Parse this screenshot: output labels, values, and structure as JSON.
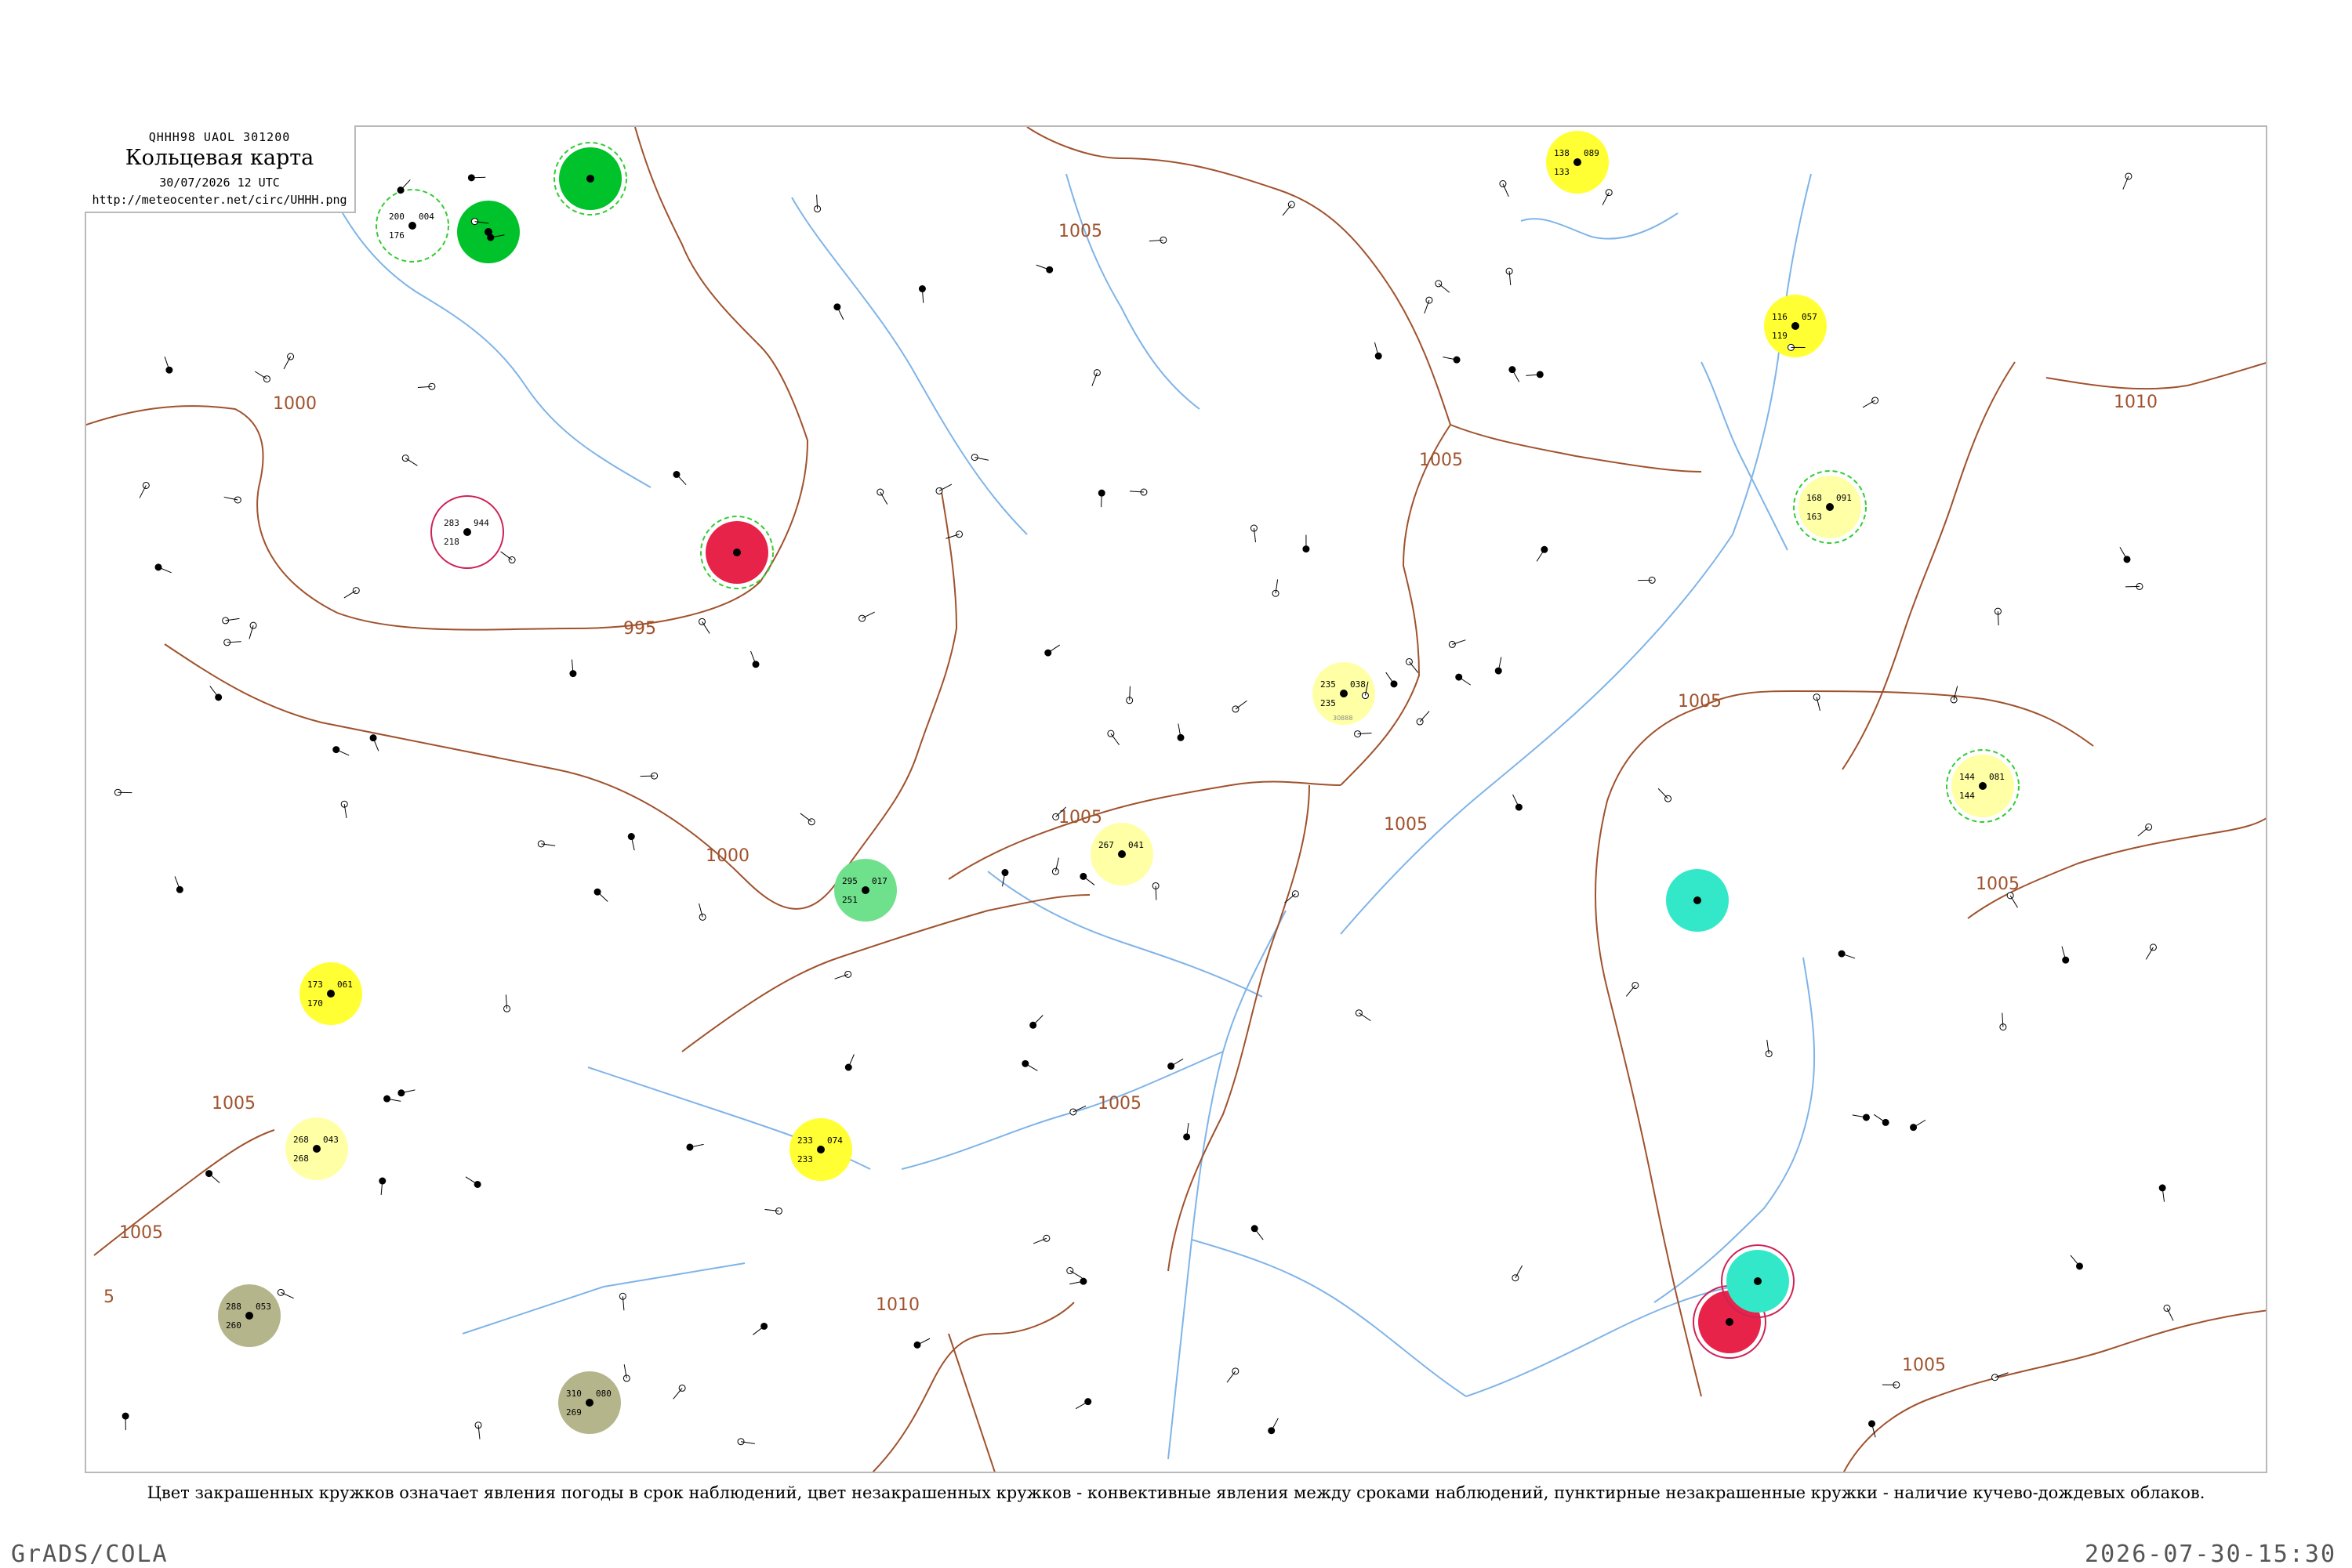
{
  "header": {
    "code": "QHHH98 UAOL 301200",
    "title": "Кольцевая карта",
    "date": "30/07/2026 12 UTC",
    "url": "http://meteocenter.net/circ/UHHH.png"
  },
  "caption": "Цвет закрашенных кружков означает явления погоды в срок наблюдений, цвет незакрашенных кружков - конвективные явления между сроками наблюдений, пунктирные незакрашенные кружки - наличие кучево-дождевых облаков.",
  "footer": {
    "left": "GrADS/COLA",
    "right": "2026-07-30-15:30"
  },
  "colors": {
    "isobar": "#a0522d",
    "rivers": "#7fb4e8",
    "frame": "#b9b9b9",
    "green": "#00c22a",
    "yellow": "#ffff33",
    "pale_yellow": "#ffffa6",
    "red": "#e8234a",
    "cyan": "#33e8c8",
    "olive": "#b5b58c",
    "light_green": "#6fe08c",
    "cb_ring": "#33cc33",
    "convective_ring": "#cc2255"
  },
  "isobar_labels": [
    "1000",
    "995",
    "1000",
    "1005",
    "1005",
    "1005",
    "1005",
    "1005",
    "1005",
    "1005",
    "1005",
    "1010",
    "1010",
    "1005",
    "1005",
    "5"
  ],
  "stations": [
    {
      "id": "st1",
      "fill": "green",
      "ring": "cb",
      "t": "",
      "p": "",
      "dp": "",
      "id_label": ""
    },
    {
      "id": "st2",
      "fill": "none",
      "ring": "cb",
      "t": "200",
      "p": "004",
      "dp": "176",
      "id_label": ""
    },
    {
      "id": "st3",
      "fill": "green",
      "ring": "none",
      "t": "",
      "p": "",
      "dp": "",
      "id_label": ""
    },
    {
      "id": "st4",
      "fill": "yellow",
      "ring": "none",
      "t": "138",
      "p": "089",
      "dp": "133",
      "id_label": ""
    },
    {
      "id": "st5",
      "fill": "red",
      "ring": "cb",
      "t": "",
      "p": "",
      "dp": "",
      "id_label": ""
    },
    {
      "id": "st6",
      "fill": "pale_yellow",
      "ring": "none",
      "t": "235",
      "p": "038",
      "dp": "235",
      "id_label": "30888"
    },
    {
      "id": "st7",
      "fill": "yellow",
      "ring": "none",
      "t": "116",
      "p": "057",
      "dp": "119",
      "id_label": ""
    },
    {
      "id": "st8",
      "fill": "pale_yellow",
      "ring": "cb",
      "t": "168",
      "p": "091",
      "dp": "163",
      "id_label": ""
    },
    {
      "id": "st9",
      "fill": "pale_yellow",
      "ring": "cb",
      "t": "144",
      "p": "081",
      "dp": "144",
      "id_label": ""
    },
    {
      "id": "st10",
      "fill": "pale_yellow",
      "ring": "none",
      "t": "267",
      "p": "041",
      "dp": "",
      "id_label": ""
    },
    {
      "id": "st11",
      "fill": "light_green",
      "ring": "none",
      "t": "295",
      "p": "017",
      "dp": "251",
      "id_label": ""
    },
    {
      "id": "st12",
      "fill": "yellow",
      "ring": "none",
      "t": "173",
      "p": "061",
      "dp": "170",
      "id_label": ""
    },
    {
      "id": "st13",
      "fill": "pale_yellow",
      "ring": "none",
      "t": "268",
      "p": "043",
      "dp": "268",
      "id_label": ""
    },
    {
      "id": "st14",
      "fill": "yellow",
      "ring": "none",
      "t": "233",
      "p": "074",
      "dp": "233",
      "id_label": ""
    },
    {
      "id": "st15",
      "fill": "olive",
      "ring": "none",
      "t": "288",
      "p": "053",
      "dp": "260",
      "id_label": ""
    },
    {
      "id": "st16",
      "fill": "olive",
      "ring": "none",
      "t": "310",
      "p": "080",
      "dp": "269",
      "id_label": ""
    },
    {
      "id": "st17",
      "fill": "cyan",
      "ring": "none",
      "t": "",
      "p": "",
      "dp": "",
      "id_label": ""
    },
    {
      "id": "st18",
      "fill": "red",
      "ring": "convective",
      "t": "",
      "p": "",
      "dp": "",
      "id_label": ""
    },
    {
      "id": "st19",
      "fill": "cyan",
      "ring": "convective",
      "t": "",
      "p": "",
      "dp": "",
      "id_label": ""
    },
    {
      "id": "st20",
      "fill": "none",
      "ring": "convective",
      "t": "283",
      "p": "944",
      "dp": "218",
      "id_label": ""
    }
  ]
}
